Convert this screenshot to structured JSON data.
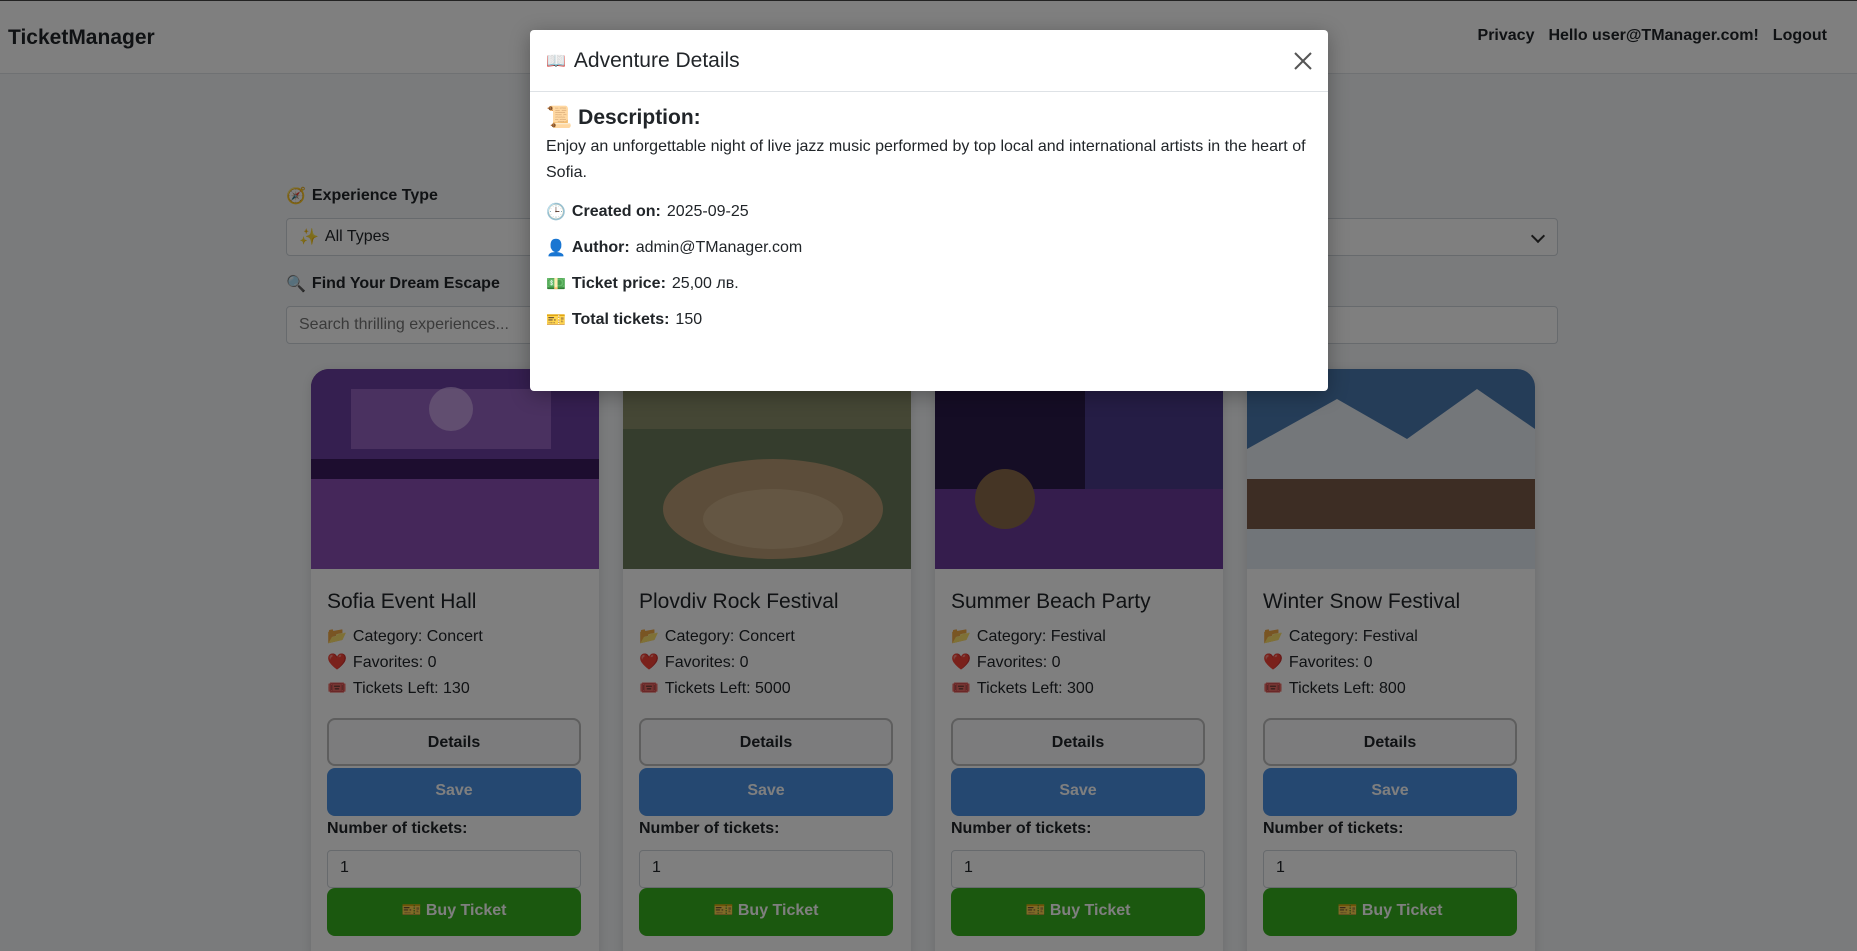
{
  "navbar": {
    "brand": "TicketManager",
    "privacy": "Privacy",
    "greeting": "Hello user@TManager.com!",
    "logout": "Logout"
  },
  "filters": {
    "type_label": "Experience Type",
    "type_value": "All Types",
    "search_label": "Find Your Dream Escape",
    "search_placeholder": "Search thrilling experiences..."
  },
  "cards": [
    {
      "title": "Sofia Event Hall",
      "category": "Category: Concert",
      "favorites": "Favorites: 0",
      "tickets_left": "Tickets Left: 130",
      "details": "Details",
      "save": "Save",
      "tickets_label": "Number of tickets:",
      "qty": "1",
      "buy": "Buy Ticket"
    },
    {
      "title": "Plovdiv Rock Festival",
      "category": "Category: Concert",
      "favorites": "Favorites: 0",
      "tickets_left": "Tickets Left: 5000",
      "details": "Details",
      "save": "Save",
      "tickets_label": "Number of tickets:",
      "qty": "1",
      "buy": "Buy Ticket"
    },
    {
      "title": "Summer Beach Party",
      "category": "Category: Festival",
      "favorites": "Favorites: 0",
      "tickets_left": "Tickets Left: 300",
      "details": "Details",
      "save": "Save",
      "tickets_label": "Number of tickets:",
      "qty": "1",
      "buy": "Buy Ticket"
    },
    {
      "title": "Winter Snow Festival",
      "category": "Category: Festival",
      "favorites": "Favorites: 0",
      "tickets_left": "Tickets Left: 800",
      "details": "Details",
      "save": "Save",
      "tickets_label": "Number of tickets:",
      "qty": "1",
      "buy": "Buy Ticket"
    }
  ],
  "modal": {
    "title": "Adventure Details",
    "description_heading": "Description:",
    "description": "Enjoy an unforgettable night of live jazz music performed by top local and international artists in the heart of Sofia.",
    "created_label": "Created on:",
    "created_value": "2025-09-25",
    "author_label": "Author:",
    "author_value": "admin@TManager.com",
    "price_label": "Ticket price:",
    "price_value": "25,00 лв.",
    "total_label": "Total tickets:",
    "total_value": "150"
  },
  "colors": {
    "primary": "#4a90e2",
    "success": "#37b01e",
    "overlay": "rgba(0,0,0,0.5)"
  }
}
